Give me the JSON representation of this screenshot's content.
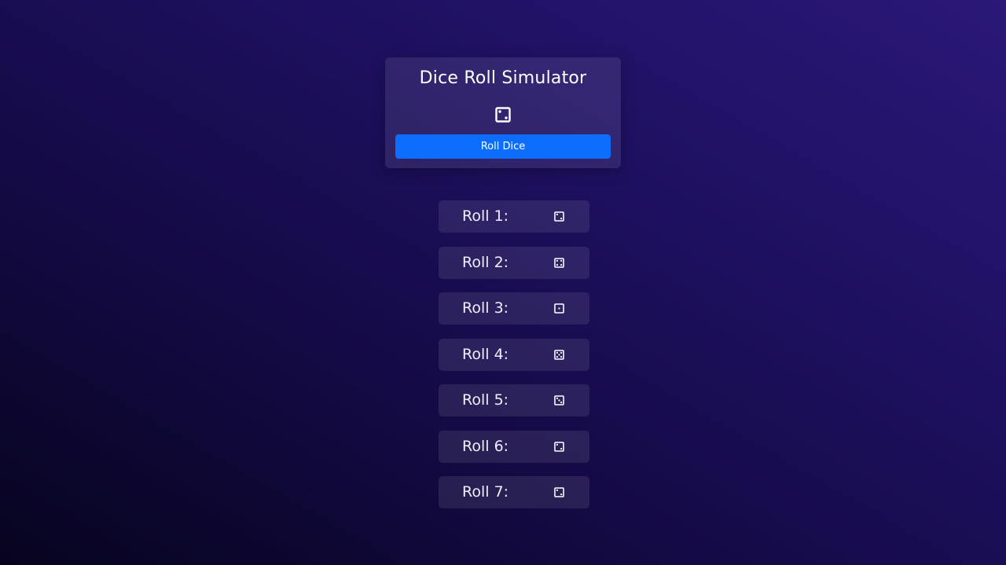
{
  "app": {
    "title": "Dice Roll Simulator",
    "current_face": 2,
    "current_icon": "die-face-2-icon",
    "button_label": "Roll Dice"
  },
  "colors": {
    "button": "#0d6efd",
    "background_dark": "#07041f",
    "background_light": "#2b1878"
  },
  "history": [
    {
      "label": "Roll 1:",
      "face": 2,
      "icon": "die-face-2-icon"
    },
    {
      "label": "Roll 2:",
      "face": 4,
      "icon": "die-face-4-icon"
    },
    {
      "label": "Roll 3:",
      "face": 1,
      "icon": "die-face-1-icon"
    },
    {
      "label": "Roll 4:",
      "face": 5,
      "icon": "die-face-5-icon"
    },
    {
      "label": "Roll 5:",
      "face": 3,
      "icon": "die-face-3-icon"
    },
    {
      "label": "Roll 6:",
      "face": 2,
      "icon": "die-face-2-icon"
    },
    {
      "label": "Roll 7:",
      "face": 2,
      "icon": "die-face-2-icon"
    }
  ]
}
